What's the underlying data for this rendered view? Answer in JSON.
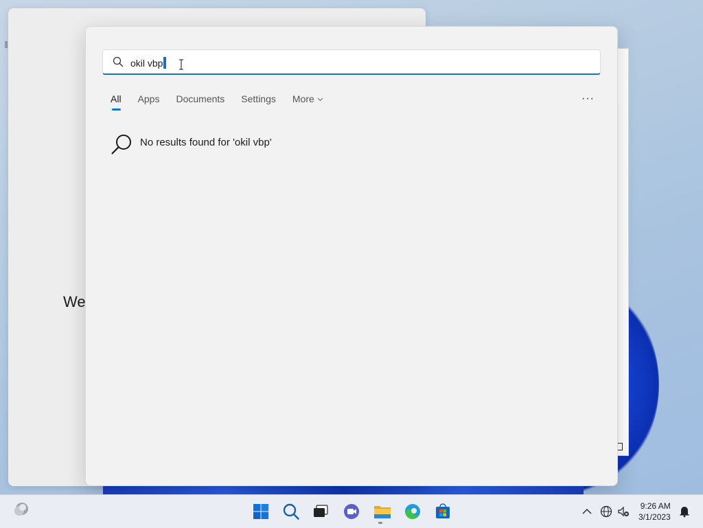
{
  "background_window": {
    "heading_fragment": "We"
  },
  "search": {
    "query": "okil vbp",
    "tabs": [
      {
        "label": "All",
        "active": true
      },
      {
        "label": "Apps",
        "active": false
      },
      {
        "label": "Documents",
        "active": false
      },
      {
        "label": "Settings",
        "active": false
      },
      {
        "label": "More",
        "active": false
      }
    ],
    "more_options_label": "···",
    "no_results_message": "No results found for 'okil vbp'"
  },
  "taskbar": {
    "pinned": [
      {
        "name": "start-icon"
      },
      {
        "name": "search-icon"
      },
      {
        "name": "task-view-icon"
      },
      {
        "name": "chat-icon"
      },
      {
        "name": "file-explorer-icon"
      },
      {
        "name": "edge-icon"
      },
      {
        "name": "store-icon"
      }
    ],
    "tray": {
      "time": "9:26 AM",
      "date": "3/1/2023"
    }
  },
  "colors": {
    "accent": "#1f6fb8",
    "panel_bg": "#f2f2f2",
    "taskbar_bg": "#eaeef4"
  }
}
